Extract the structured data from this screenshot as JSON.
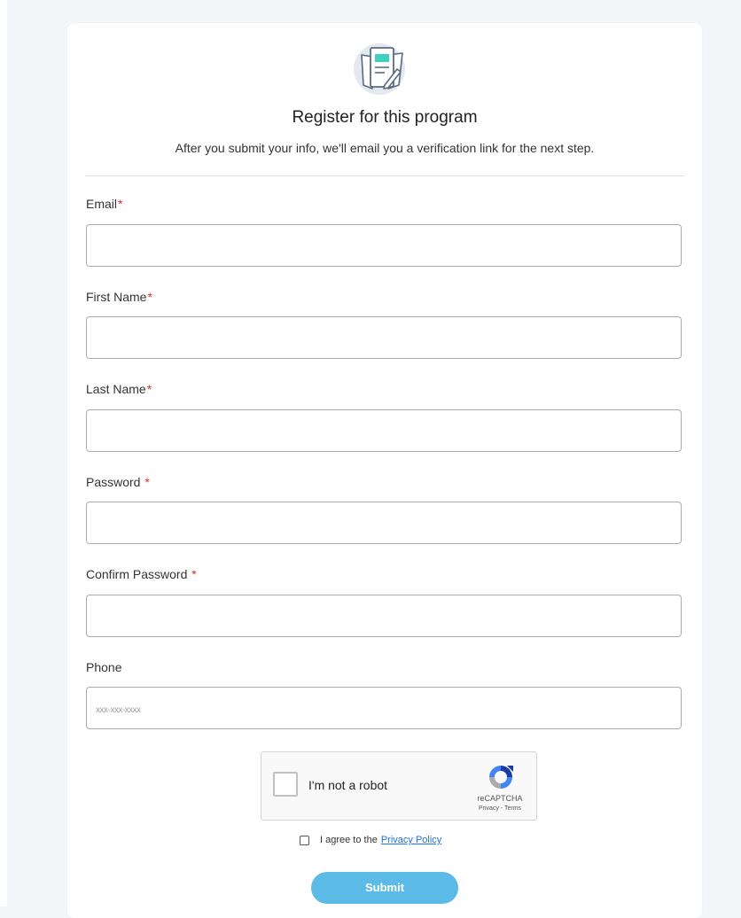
{
  "header": {
    "icon": "document-pen-icon",
    "title": "Register for this program",
    "subtitle": "After you submit your info, we'll email you a verification link for the next step."
  },
  "form": {
    "required_marker": "*",
    "email": {
      "label": "Email",
      "value": "",
      "placeholder": ""
    },
    "first_name": {
      "label": "First Name",
      "value": "",
      "placeholder": ""
    },
    "last_name": {
      "label": "Last Name",
      "value": "",
      "placeholder": ""
    },
    "password": {
      "label": "Password",
      "value": "",
      "placeholder": ""
    },
    "confirm_password": {
      "label": "Confirm Password",
      "value": "",
      "placeholder": ""
    },
    "phone": {
      "label": "Phone",
      "value": "",
      "placeholder": "xxx-xxx-xxxx"
    }
  },
  "recaptcha": {
    "label": "I'm not a robot",
    "brand": "reCAPTCHA",
    "links": "Privacy - Terms",
    "icon": "recaptcha-logo-icon"
  },
  "agreement": {
    "prefix": "I agree to the",
    "link_text": "Privacy Policy",
    "checked": false
  },
  "submit_label": "Submit",
  "colors": {
    "accent": "#5bbbe6",
    "required": "#d93025",
    "link": "#1a73e8",
    "icon_teal": "#3fd1c0"
  }
}
